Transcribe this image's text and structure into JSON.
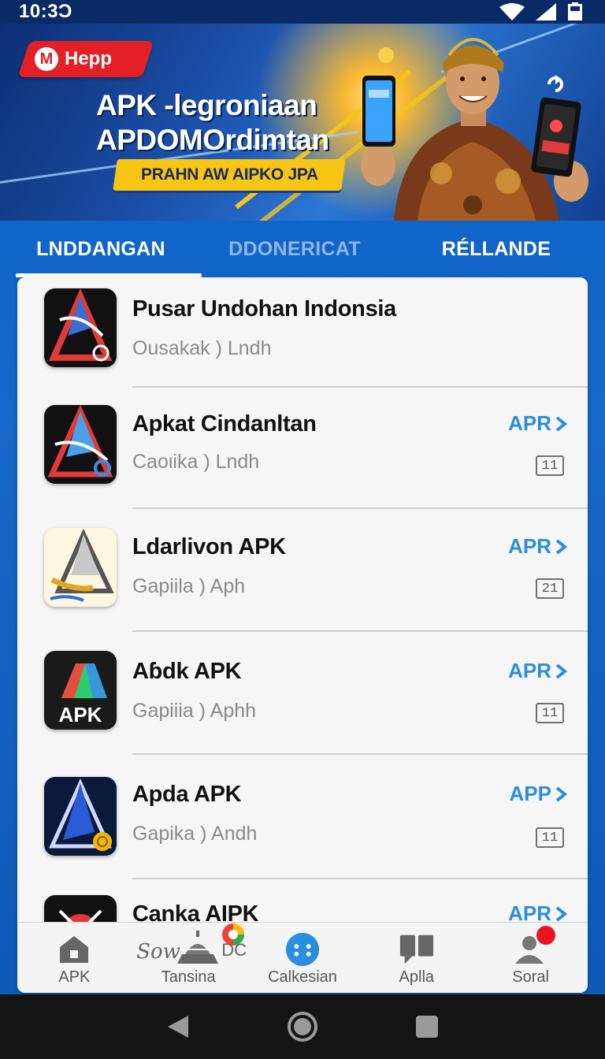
{
  "status": {
    "time": "10:3Ɔ"
  },
  "banner": {
    "logo_text": "Hepp",
    "logo_mark": "M",
    "title_line1": "APK -legroniaan",
    "title_line2": "APDOMOrdimtan",
    "pill_text": "PRAHN AW AIPKO JPA"
  },
  "tabs": [
    {
      "label": "LNDDANGAN",
      "active": true
    },
    {
      "label": "DDONERICAT",
      "active": false
    },
    {
      "label": "RÉLLANDE",
      "active": false
    }
  ],
  "apps": [
    {
      "name": "Pusar Undohan Indonsia",
      "sub": "Ousakak ) Lndh",
      "action": "",
      "count": ""
    },
    {
      "name": "Apkat Cindanltan",
      "sub": "Caoιika ) Lndh",
      "action": "APR",
      "count": "11"
    },
    {
      "name": "Ldarlivon APK",
      "sub": "Gapiila ) Aph",
      "action": "APR",
      "count": "21"
    },
    {
      "name": "Aɓdk APK",
      "sub": "Gapiiia ) Aphh",
      "action": "APR",
      "count": "11"
    },
    {
      "name": "Apda APK",
      "sub": "Gapika ) Andh",
      "action": "APP",
      "count": "11"
    },
    {
      "name": "Canka AIPK",
      "sub": "",
      "action": "APR",
      "count": ""
    }
  ],
  "icon_labels": {
    "apk_badge": "APK"
  },
  "nav": [
    {
      "label": "APK",
      "icon": "home-icon"
    },
    {
      "label": "Tansina",
      "icon": "temple-icon",
      "deco": "Sow",
      "deco2": "DC"
    },
    {
      "label": "Calkesian",
      "icon": "dots-circle-icon"
    },
    {
      "label": "Aplla",
      "icon": "chat-icon"
    },
    {
      "label": "Soral",
      "icon": "profile-icon"
    }
  ],
  "colors": {
    "accent": "#2a8ee0",
    "brand_red": "#e32026",
    "banner_yellow": "#f9c515",
    "tab_inactive": "#8fb6e6"
  }
}
